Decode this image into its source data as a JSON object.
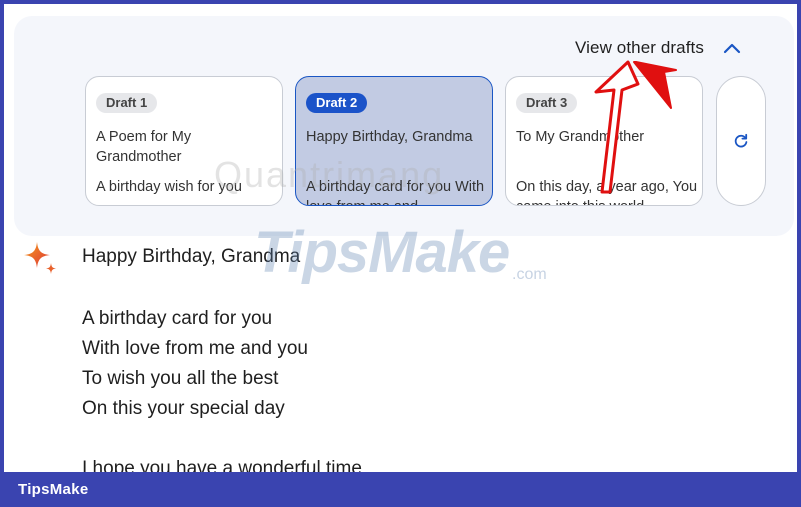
{
  "header": {
    "toggle_label": "View other drafts",
    "toggle_icon": "chevron-up-icon"
  },
  "drafts": [
    {
      "chip": "Draft 1",
      "title": "A Poem for My Grandmother",
      "preview": "A birthday wish for you",
      "selected": false
    },
    {
      "chip": "Draft 2",
      "title": "Happy Birthday, Grandma",
      "preview": "A birthday card for you With love from me and",
      "selected": true
    },
    {
      "chip": "Draft 3",
      "title": "To My Grandmother",
      "preview": "On this day, a year ago, You came into this world",
      "selected": false
    }
  ],
  "regenerate_icon": "refresh-icon",
  "response": {
    "heading": "Happy Birthday, Grandma",
    "stanza1": [
      "A birthday card for you",
      "With love from me and you",
      "To wish you all the best",
      "On this your special day"
    ],
    "stanza2": [
      "I hope you have a wonderful time"
    ]
  },
  "watermark": {
    "top": "Quantrimang",
    "main": "TipsMake",
    "suffix": ".com"
  },
  "footer": {
    "brand": "TipsMake"
  },
  "colors": {
    "selected_chip": "#1b53c9",
    "selected_card": "#c2cbe3",
    "annotation_arrow": "#e01010",
    "footer_bar": "#3a44b0"
  }
}
